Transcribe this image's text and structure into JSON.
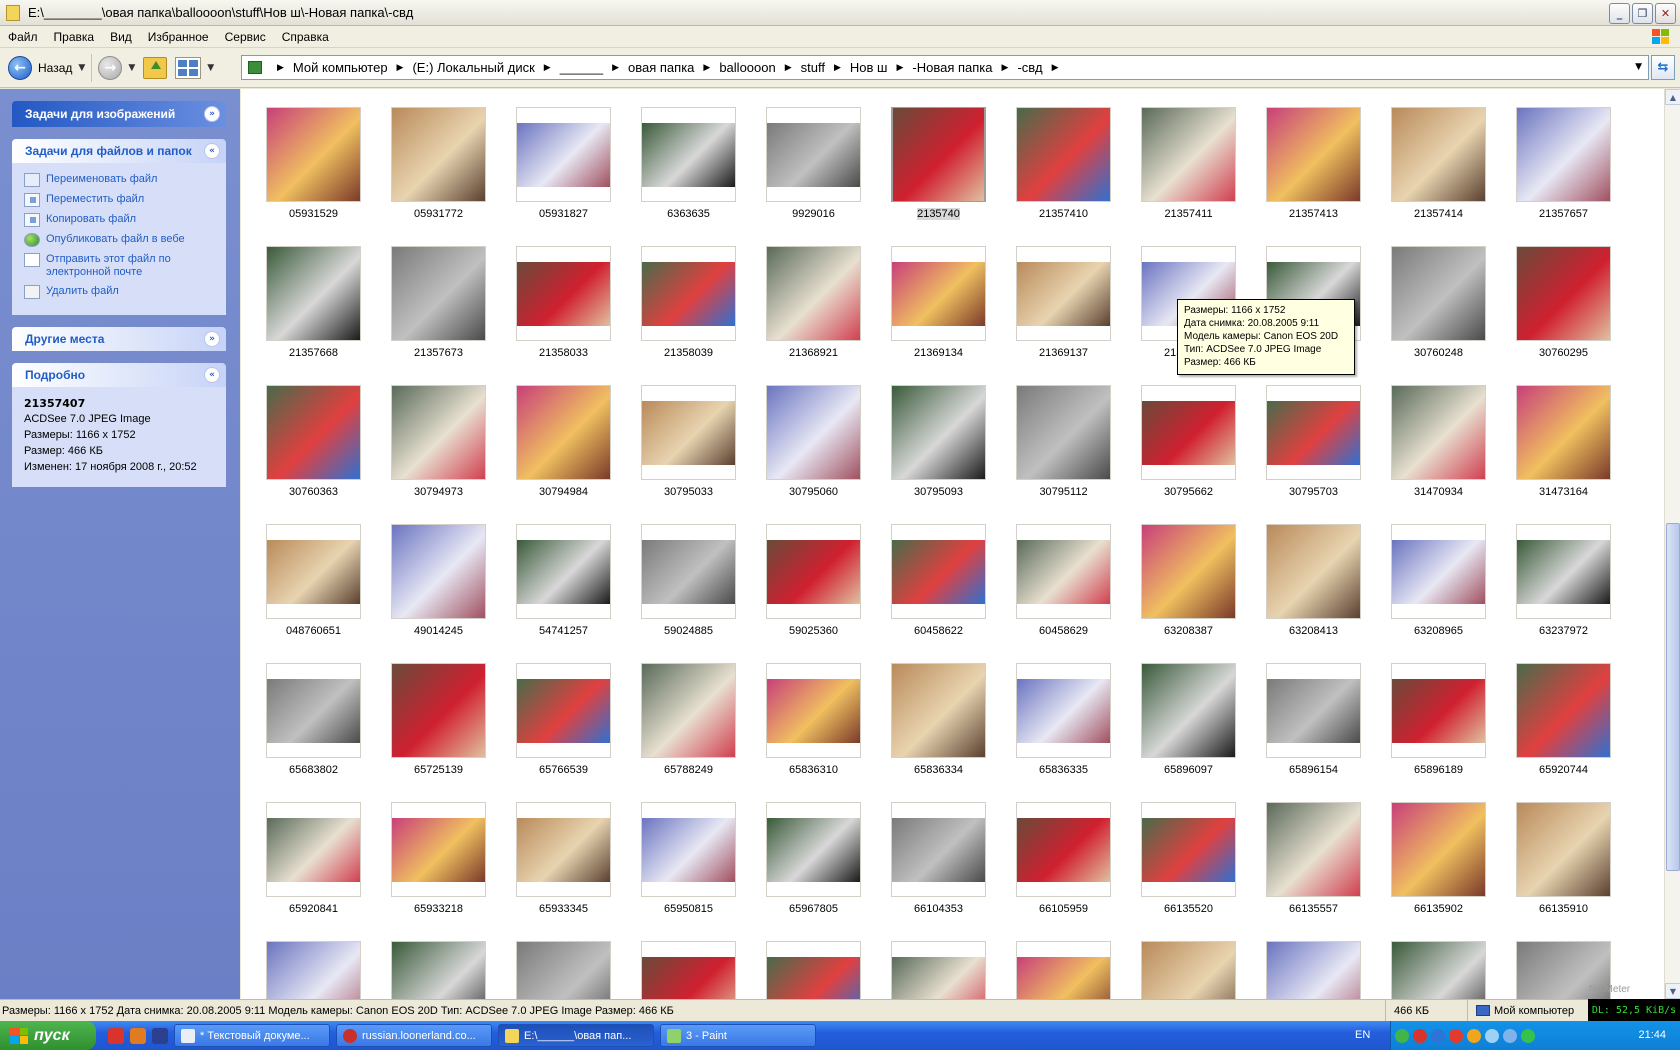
{
  "window": {
    "title": "E:\\________\\овая папка\\balloooon\\stuff\\Нов ш\\-Новая папка\\-свд"
  },
  "menu": [
    "Файл",
    "Правка",
    "Вид",
    "Избранное",
    "Сервис",
    "Справка"
  ],
  "toolbar": {
    "back_label": "Назад"
  },
  "address": {
    "crumbs": [
      "Мой компьютер",
      "(E:) Локальный диск",
      "______",
      "овая папка",
      "balloooon",
      "stuff",
      "Нов ш",
      "-Новая папка",
      "-свд"
    ]
  },
  "left_pane": {
    "image_tasks": {
      "title": "Задачи для изображений"
    },
    "file_tasks": {
      "title": "Задачи для файлов и папок",
      "items": [
        {
          "label": "Переименовать файл",
          "icon": "rename-icon"
        },
        {
          "label": "Переместить файл",
          "icon": "move-icon"
        },
        {
          "label": "Копировать файл",
          "icon": "copy-icon"
        },
        {
          "label": "Опубликовать файл в вебе",
          "icon": "web-publish-icon"
        },
        {
          "label": "Отправить этот файл по электронной почте",
          "icon": "email-icon"
        },
        {
          "label": "Удалить файл",
          "icon": "delete-icon"
        }
      ]
    },
    "other_places": {
      "title": "Другие места"
    },
    "details": {
      "title": "Подробно",
      "name": "21357407",
      "type": "ACDSee 7.0 JPEG Image",
      "dimensions": "Размеры: 1166 x 1752",
      "size": "Размер: 466 КБ",
      "modified": "Изменен: 17 ноября 2008 г., 20:52"
    }
  },
  "thumbnails": [
    "05931529",
    "05931772",
    "05931827",
    "6363635",
    "9929016",
    "21357407",
    "21357410",
    "21357411",
    "21357413",
    "21357414",
    "21357657",
    "21357668",
    "21357673",
    "21358033",
    "21358039",
    "21368921",
    "21369134",
    "21369137",
    "21369171",
    "30760224",
    "30760248",
    "30760295",
    "30760363",
    "30794973",
    "30794984",
    "30795033",
    "30795060",
    "30795093",
    "30795112",
    "30795662",
    "30795703",
    "31470934",
    "31473164",
    "048760651",
    "49014245",
    "54741257",
    "59024885",
    "59025360",
    "60458622",
    "60458629",
    "63208387",
    "63208413",
    "63208965",
    "63237972",
    "65683802",
    "65725139",
    "65766539",
    "65788249",
    "65836310",
    "65836334",
    "65836335",
    "65896097",
    "65896154",
    "65896189",
    "65920744",
    "65920841",
    "65933218",
    "65933345",
    "65950815",
    "65967805",
    "66104353",
    "66105959",
    "66135520",
    "66135557",
    "66135902",
    "66135910",
    "",
    "",
    "",
    "",
    "",
    "",
    "",
    "",
    "",
    "",
    ""
  ],
  "selected_thumbnail": "2135740",
  "tooltip": {
    "lines": [
      "Размеры: 1166 x 1752",
      "Дата снимка: 20.08.2005 9:11",
      "Модель камеры: Canon EOS 20D",
      "Тип: ACDSee 7.0 JPEG Image",
      "Размер: 466 КБ"
    ]
  },
  "statusbar": {
    "main": "Размеры: 1166 x 1752 Дата снимка: 20.08.2005 9:11 Модель камеры: Canon EOS 20D Тип: ACDSee 7.0 JPEG Image Размер: 466 КБ",
    "size": "466 КБ",
    "zone": "Мой компьютер"
  },
  "netmeter": {
    "label": "NetMeter",
    "value": "DL: 52,5 KiB/s"
  },
  "taskbar": {
    "start_label": "пуск",
    "buttons": [
      "* Текстовый докуме...",
      "russian.loonerland.co...",
      "E:\\______\\овая пап...",
      "3 - Paint"
    ],
    "active_index": 2,
    "lang": "EN",
    "clock": "21:44"
  },
  "colors": {
    "left_pane_bg": "#6b7fc6",
    "link_blue": "#215dc6",
    "taskbar_blue": "#245edb",
    "start_green": "#2e8f2e"
  }
}
